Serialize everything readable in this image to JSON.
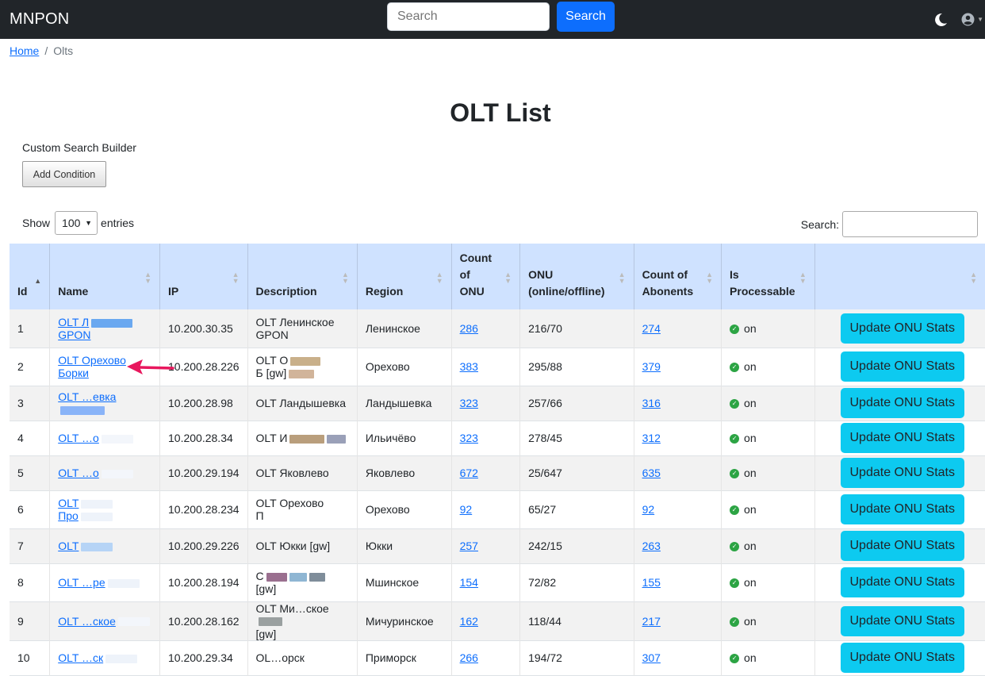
{
  "navbar": {
    "brand": "MNPON",
    "search_placeholder": "Search",
    "search_button": "Search"
  },
  "breadcrumb": {
    "home": "Home",
    "separator": "/",
    "current": "Olts"
  },
  "page": {
    "title": "OLT List"
  },
  "search_builder": {
    "title": "Custom Search Builder",
    "add_condition": "Add Condition"
  },
  "length": {
    "show": "Show",
    "value": "100",
    "entries": "entries"
  },
  "table_search": {
    "label": "Search:"
  },
  "table": {
    "columns": [
      {
        "key": "id",
        "lines": [
          "Id"
        ]
      },
      {
        "key": "name",
        "lines": [
          "Name"
        ]
      },
      {
        "key": "ip",
        "lines": [
          "IP"
        ]
      },
      {
        "key": "description",
        "lines": [
          "Description"
        ]
      },
      {
        "key": "region",
        "lines": [
          "Region"
        ]
      },
      {
        "key": "count_onu",
        "lines": [
          "Count",
          "of",
          "ONU"
        ]
      },
      {
        "key": "onu_status",
        "lines": [
          "ONU",
          "(online/offline)"
        ]
      },
      {
        "key": "abonents",
        "lines": [
          "Count of",
          "Abonents"
        ]
      },
      {
        "key": "processable",
        "lines": [
          "Is",
          "Processable"
        ]
      },
      {
        "key": "action",
        "lines": [
          ""
        ]
      }
    ],
    "rows": [
      {
        "id": "1",
        "name": [
          "OLT Л",
          "GPON"
        ],
        "ip": "10.200.30.35",
        "desc": [
          "OLT Ленинское",
          "GPON"
        ],
        "region": "Ленинское",
        "onu": "286",
        "status": "216/70",
        "abonents": "274",
        "proc": "on",
        "action": "Update ONU Stats"
      },
      {
        "id": "2",
        "name": [
          "OLT Орехово",
          "Борки"
        ],
        "ip": "10.200.28.226",
        "desc": [
          "OLT О",
          "Б [gw]"
        ],
        "region": "Орехово",
        "onu": "383",
        "status": "295/88",
        "abonents": "379",
        "proc": "on",
        "action": "Update ONU Stats"
      },
      {
        "id": "3",
        "name": [
          "OLT …евка"
        ],
        "ip": "10.200.28.98",
        "desc": [
          "OLT Ландышевка"
        ],
        "region": "Ландышевка",
        "onu": "323",
        "status": "257/66",
        "abonents": "316",
        "proc": "on",
        "action": "Update ONU Stats"
      },
      {
        "id": "4",
        "name": [
          "OLT …о"
        ],
        "ip": "10.200.28.34",
        "desc": [
          "OLT И"
        ],
        "region": "Ильичёво",
        "onu": "323",
        "status": "278/45",
        "abonents": "312",
        "proc": "on",
        "action": "Update ONU Stats"
      },
      {
        "id": "5",
        "name": [
          "OLT …о"
        ],
        "ip": "10.200.29.194",
        "desc": [
          "OLT Яковлево"
        ],
        "region": "Яковлево",
        "onu": "672",
        "status": "25/647",
        "abonents": "635",
        "proc": "on",
        "action": "Update ONU Stats"
      },
      {
        "id": "6",
        "name": [
          "OLT",
          "Про"
        ],
        "ip": "10.200.28.234",
        "desc": [
          "OLT Орехово",
          "П"
        ],
        "region": "Орехово",
        "onu": "92",
        "status": "65/27",
        "abonents": "92",
        "proc": "on",
        "action": "Update ONU Stats"
      },
      {
        "id": "7",
        "name": [
          "OLT"
        ],
        "ip": "10.200.29.226",
        "desc": [
          "OLT Юкки [gw]"
        ],
        "region": "Юкки",
        "onu": "257",
        "status": "242/15",
        "abonents": "263",
        "proc": "on",
        "action": "Update ONU Stats"
      },
      {
        "id": "8",
        "name": [
          "OLT …ре"
        ],
        "ip": "10.200.28.194",
        "desc": [
          "C",
          "[gw]"
        ],
        "region": "Мшинское",
        "onu": "154",
        "status": "72/82",
        "abonents": "155",
        "proc": "on",
        "action": "Update ONU Stats"
      },
      {
        "id": "9",
        "name": [
          "OLT …ское"
        ],
        "ip": "10.200.28.162",
        "desc": [
          "OLT Ми…ское",
          "[gw]"
        ],
        "region": "Мичуринское",
        "onu": "162",
        "status": "118/44",
        "abonents": "217",
        "proc": "on",
        "action": "Update ONU Stats"
      },
      {
        "id": "10",
        "name": [
          "OLT …ск"
        ],
        "ip": "10.200.29.34",
        "desc": [
          "OL…орск"
        ],
        "region": "Приморск",
        "onu": "266",
        "status": "194/72",
        "abonents": "307",
        "proc": "on",
        "action": "Update ONU Stats"
      }
    ]
  }
}
